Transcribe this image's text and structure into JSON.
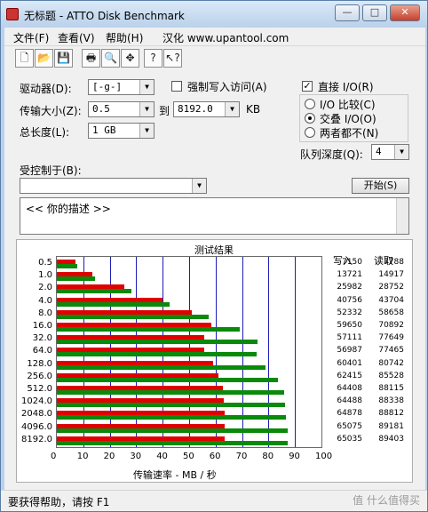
{
  "window": {
    "title": "无标题 - ATTO Disk Benchmark"
  },
  "menu": {
    "items": [
      "文件(F)",
      "查看(V)",
      "帮助(H)",
      "汉化 www.upantool.com"
    ]
  },
  "toolbar": {
    "icons": [
      "new-document-icon",
      "open-folder-icon",
      "save-icon",
      "print-icon",
      "print-preview-icon",
      "move-icon",
      "help-icon",
      "context-help-icon"
    ]
  },
  "form": {
    "drive_label": "驱动器(D):",
    "drive_value": "[-g-]",
    "force_write_label": "强制写入访问(A)",
    "transfer_label": "传输大小(Z):",
    "transfer_from": "0.5",
    "to_label": "到",
    "transfer_to": "8192.0",
    "kb_label": "KB",
    "total_label": "总长度(L):",
    "total_value": "1 GB",
    "direct_io_label": "直接 I/O(R)",
    "io_compare_label": "I/O 比较(C)",
    "overlap_io_label": "交叠 I/O(O)",
    "neither_label": "两者都不(N)",
    "queue_label": "队列深度(Q):",
    "queue_value": "4",
    "controlled_label": "受控制于(B):",
    "start_label": "开始(S)",
    "desc_text": "<<   你的描述    >>"
  },
  "chart_data": {
    "type": "bar",
    "title": "测试结果",
    "xlabel": "传输速率 - MB / 秒",
    "xlim": [
      0,
      100
    ],
    "xticks": [
      "0",
      "10",
      "20",
      "30",
      "40",
      "50",
      "60",
      "70",
      "80",
      "90",
      "100"
    ],
    "legend_placement": "top",
    "categories": [
      "0.5",
      "1.0",
      "2.0",
      "4.0",
      "8.0",
      "16.0",
      "32.0",
      "64.0",
      "128.0",
      "256.0",
      "512.0",
      "1024.0",
      "2048.0",
      "4096.0",
      "8192.0"
    ],
    "series": [
      {
        "name": "写入",
        "color": "#e00000",
        "values": [
          7150,
          13721,
          25982,
          40756,
          52332,
          59650,
          57111,
          56987,
          60401,
          62415,
          64408,
          64488,
          64878,
          65075,
          65035
        ]
      },
      {
        "name": "读取",
        "color": "#0a8a0a",
        "values": [
          7788,
          14917,
          28752,
          43704,
          58658,
          70892,
          77649,
          77465,
          80742,
          85528,
          88115,
          88338,
          88812,
          89181,
          89403
        ]
      }
    ],
    "write_header": "写入",
    "read_header": "读取"
  },
  "status": {
    "text": "要获得帮助，请按 F1",
    "watermark": "值 什么值得买"
  }
}
